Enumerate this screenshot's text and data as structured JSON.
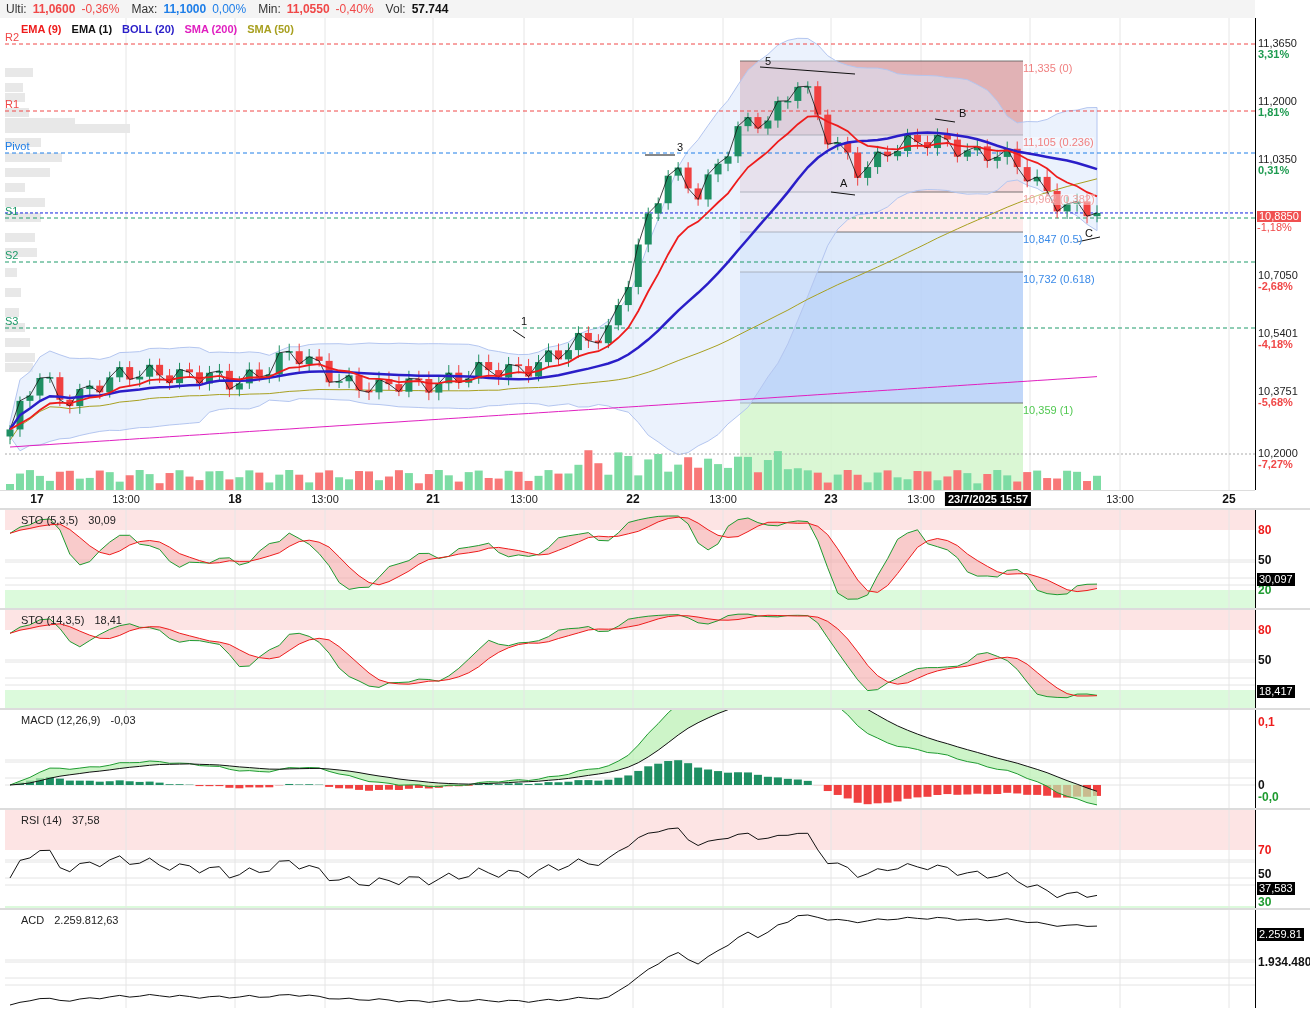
{
  "quote_bar": [
    {
      "label": "Ulti:",
      "value": "11,0600",
      "change": "-0,36%",
      "color": "#f04848"
    },
    {
      "label": "Max:",
      "value": "11,1000",
      "change": "0,00%",
      "color": "#1e7ee8"
    },
    {
      "label": "Min:",
      "value": "11,0550",
      "change": "-0,40%",
      "color": "#f04848"
    },
    {
      "label": "Vol:",
      "value": "57.744"
    }
  ],
  "legend": [
    {
      "label": "EMA (9)",
      "color": "#ee1c1c"
    },
    {
      "label": "EMA (1)",
      "color": "#111111"
    },
    {
      "label": "BOLL (20)",
      "color": "#2a1ec8"
    },
    {
      "label": "SMA (200)",
      "color": "#e020c0"
    },
    {
      "label": "SMA (50)",
      "color": "#a8a020"
    }
  ],
  "pivots": [
    {
      "label": "R2",
      "color": "#f04848"
    },
    {
      "label": "R1",
      "color": "#f04848"
    },
    {
      "label": "Pivot",
      "color": "#1e7ee8"
    },
    {
      "label": "S1",
      "color": "#1e9b6a"
    },
    {
      "label": "S2",
      "color": "#1e9b6a"
    },
    {
      "label": "S3",
      "color": "#1e9b6a"
    }
  ],
  "fibonacci": [
    {
      "label": "11,335 (0)",
      "color": "#f08080"
    },
    {
      "label": "11,105 (0.236)",
      "color": "#f08080"
    },
    {
      "label": "10,962 (0.382)",
      "color": "#f0a0a0"
    },
    {
      "label": "10,847 (0.5)",
      "color": "#3a8ae8"
    },
    {
      "label": "10,732 (0.618)",
      "color": "#3a8ae8"
    },
    {
      "label": "10,359 (1)",
      "color": "#50c850"
    }
  ],
  "wave_labels": [
    "5",
    "3",
    "1",
    "B",
    "A",
    "C"
  ],
  "price_axis": [
    {
      "price": "11,3650",
      "change": "3,31%",
      "color": "#1e9b50"
    },
    {
      "price": "11,2000",
      "change": "1,81%",
      "color": "#1e9b50"
    },
    {
      "price": "11,0350",
      "change": "0,31%",
      "color": "#1e9b50"
    },
    {
      "price": "10,7050",
      "change": "-2,68%",
      "color": "#f04848"
    },
    {
      "price": "10,5401",
      "change": "-4,18%",
      "color": "#f04848"
    },
    {
      "price": "10,3751",
      "change": "-5,68%",
      "color": "#f04848"
    },
    {
      "price": "10,2000",
      "change": "-7,27%",
      "color": "#f04848"
    }
  ],
  "current_price": {
    "price": "10,8850",
    "change": "-1,18%"
  },
  "time_axis": [
    {
      "label": "17",
      "kind": "day"
    },
    {
      "label": "13:00",
      "kind": "time"
    },
    {
      "label": "18",
      "kind": "day"
    },
    {
      "label": "13:00",
      "kind": "time"
    },
    {
      "label": "21",
      "kind": "day"
    },
    {
      "label": "13:00",
      "kind": "time"
    },
    {
      "label": "22",
      "kind": "day"
    },
    {
      "label": "13:00",
      "kind": "time"
    },
    {
      "label": "23",
      "kind": "day"
    },
    {
      "label": "13:00",
      "kind": "time"
    },
    {
      "label": "23/7/2025 15:57",
      "kind": "cursor"
    },
    {
      "label": "13:00",
      "kind": "time"
    },
    {
      "label": "25",
      "kind": "day"
    }
  ],
  "panels": [
    {
      "kind": "sto_fast",
      "title": "STO (5,3,5)",
      "value": "30,09",
      "axis": [
        {
          "label": "80",
          "color": "#ee1c1c"
        },
        {
          "label": "50",
          "color": "#111111"
        },
        {
          "label": "20",
          "color": "#1e9b30"
        }
      ],
      "current": "30,097"
    },
    {
      "kind": "sto_slow",
      "title": "STO (14,3,5)",
      "value": "18,41",
      "axis": [
        {
          "label": "80",
          "color": "#ee1c1c"
        },
        {
          "label": "50",
          "color": "#111111"
        }
      ],
      "current": "18,417"
    },
    {
      "kind": "macd",
      "title": "MACD (12,26,9)",
      "value": "-0,03",
      "axis": [
        {
          "label": "0,1",
          "color": "#ee1c1c"
        },
        {
          "label": "0",
          "color": "#111111"
        },
        {
          "label": "-0,0",
          "color": "#1e9b30"
        }
      ]
    },
    {
      "kind": "rsi",
      "title": "RSI (14)",
      "value": "37,58",
      "axis": [
        {
          "label": "70",
          "color": "#ee1c1c"
        },
        {
          "label": "50",
          "color": "#111111"
        },
        {
          "label": "30",
          "color": "#1e9b30"
        }
      ],
      "current": "37,583"
    },
    {
      "kind": "acd",
      "title": "ACD",
      "value": "2.259.812,63",
      "axis": [
        {
          "label": "1.934.480",
          "color": "#111111"
        }
      ],
      "current": "2.259.81"
    }
  ]
}
